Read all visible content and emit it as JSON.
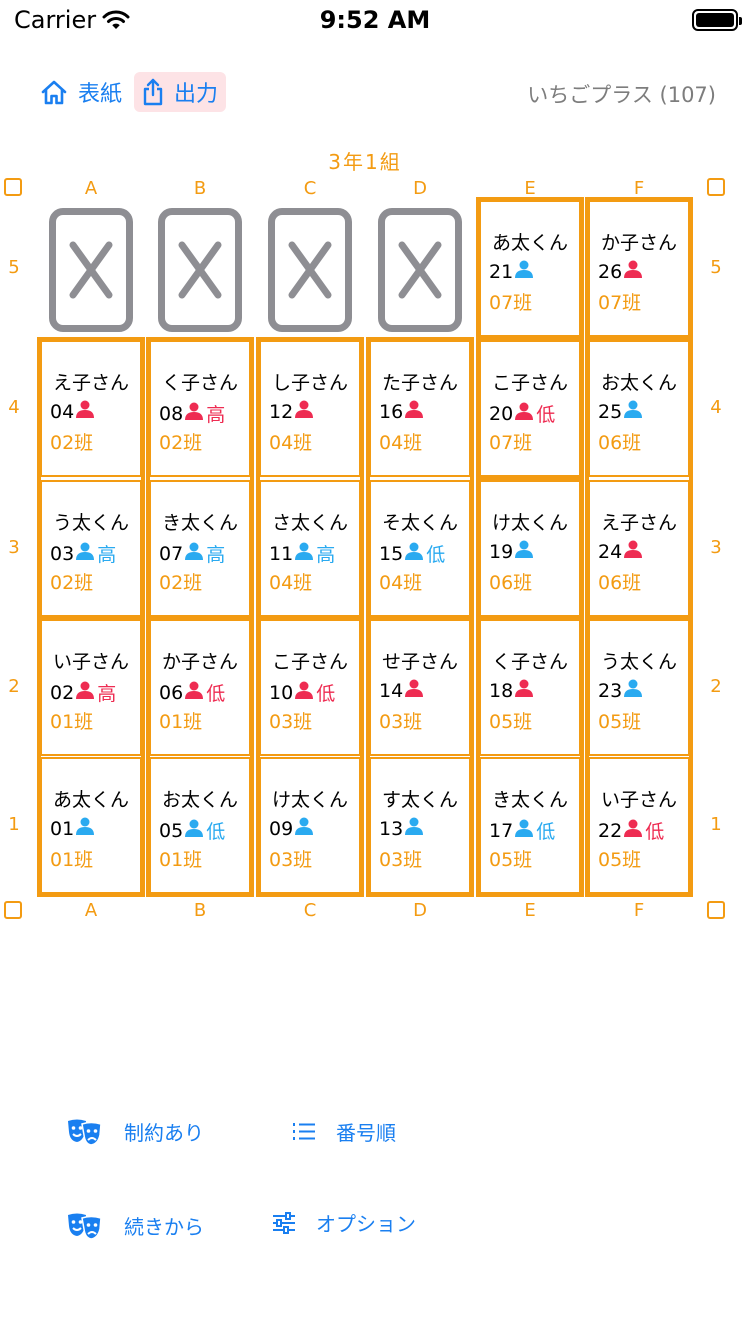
{
  "status_bar": {
    "carrier": "Carrier",
    "time": "9:52 AM"
  },
  "nav": {
    "home_label": "表紙",
    "export_label": "出力",
    "info": "いちごプラス (107)"
  },
  "chart": {
    "class_title": "3年1組",
    "columns": [
      "A",
      "B",
      "C",
      "D",
      "E",
      "F"
    ],
    "rows": [
      "5",
      "4",
      "3",
      "2",
      "1"
    ],
    "empty_seats": [
      {
        "col": "A",
        "row": "5",
        "mark": "X"
      },
      {
        "col": "B",
        "row": "5",
        "mark": "X"
      },
      {
        "col": "C",
        "row": "5",
        "mark": "X"
      },
      {
        "col": "D",
        "row": "5",
        "mark": "X"
      }
    ],
    "seats": [
      {
        "col": "E",
        "row": "5",
        "name": "あ太くん",
        "number": "21",
        "gender": "boy",
        "level": "",
        "group": "07班"
      },
      {
        "col": "F",
        "row": "5",
        "name": "か子さん",
        "number": "26",
        "gender": "girl",
        "level": "",
        "group": "07班"
      },
      {
        "col": "A",
        "row": "4",
        "name": "え子さん",
        "number": "04",
        "gender": "girl",
        "level": "",
        "group": "02班"
      },
      {
        "col": "B",
        "row": "4",
        "name": "く子さん",
        "number": "08",
        "gender": "girl",
        "level": "高",
        "group": "02班"
      },
      {
        "col": "C",
        "row": "4",
        "name": "し子さん",
        "number": "12",
        "gender": "girl",
        "level": "",
        "group": "04班"
      },
      {
        "col": "D",
        "row": "4",
        "name": "た子さん",
        "number": "16",
        "gender": "girl",
        "level": "",
        "group": "04班"
      },
      {
        "col": "E",
        "row": "4",
        "name": "こ子さん",
        "number": "20",
        "gender": "girl",
        "level": "低",
        "group": "07班"
      },
      {
        "col": "F",
        "row": "4",
        "name": "お太くん",
        "number": "25",
        "gender": "boy",
        "level": "",
        "group": "06班"
      },
      {
        "col": "A",
        "row": "3",
        "name": "う太くん",
        "number": "03",
        "gender": "boy",
        "level": "高",
        "group": "02班"
      },
      {
        "col": "B",
        "row": "3",
        "name": "き太くん",
        "number": "07",
        "gender": "boy",
        "level": "高",
        "group": "02班"
      },
      {
        "col": "C",
        "row": "3",
        "name": "さ太くん",
        "number": "11",
        "gender": "boy",
        "level": "高",
        "group": "04班"
      },
      {
        "col": "D",
        "row": "3",
        "name": "そ太くん",
        "number": "15",
        "gender": "boy",
        "level": "低",
        "group": "04班"
      },
      {
        "col": "E",
        "row": "3",
        "name": "け太くん",
        "number": "19",
        "gender": "boy",
        "level": "",
        "group": "06班"
      },
      {
        "col": "F",
        "row": "3",
        "name": "え子さん",
        "number": "24",
        "gender": "girl",
        "level": "",
        "group": "06班"
      },
      {
        "col": "A",
        "row": "2",
        "name": "い子さん",
        "number": "02",
        "gender": "girl",
        "level": "高",
        "group": "01班"
      },
      {
        "col": "B",
        "row": "2",
        "name": "か子さん",
        "number": "06",
        "gender": "girl",
        "level": "低",
        "group": "01班"
      },
      {
        "col": "C",
        "row": "2",
        "name": "こ子さん",
        "number": "10",
        "gender": "girl",
        "level": "低",
        "group": "03班"
      },
      {
        "col": "D",
        "row": "2",
        "name": "せ子さん",
        "number": "14",
        "gender": "girl",
        "level": "",
        "group": "03班"
      },
      {
        "col": "E",
        "row": "2",
        "name": "く子さん",
        "number": "18",
        "gender": "girl",
        "level": "",
        "group": "05班"
      },
      {
        "col": "F",
        "row": "2",
        "name": "う太くん",
        "number": "23",
        "gender": "boy",
        "level": "",
        "group": "05班"
      },
      {
        "col": "A",
        "row": "1",
        "name": "あ太くん",
        "number": "01",
        "gender": "boy",
        "level": "",
        "group": "01班"
      },
      {
        "col": "B",
        "row": "1",
        "name": "お太くん",
        "number": "05",
        "gender": "boy",
        "level": "低",
        "group": "01班"
      },
      {
        "col": "C",
        "row": "1",
        "name": "け太くん",
        "number": "09",
        "gender": "boy",
        "level": "",
        "group": "03班"
      },
      {
        "col": "D",
        "row": "1",
        "name": "す太くん",
        "number": "13",
        "gender": "boy",
        "level": "",
        "group": "03班"
      },
      {
        "col": "E",
        "row": "1",
        "name": "き太くん",
        "number": "17",
        "gender": "boy",
        "level": "低",
        "group": "05班"
      },
      {
        "col": "F",
        "row": "1",
        "name": "い子さん",
        "number": "22",
        "gender": "girl",
        "level": "低",
        "group": "05班"
      }
    ]
  },
  "menu": {
    "constraint_label": "制約あり",
    "order_label": "番号順",
    "continue_label": "続きから",
    "options_label": "オプション"
  },
  "colors": {
    "accent": "#1a7ff0",
    "orange": "#f39b12",
    "boy": "#2aaaf0",
    "girl": "#ee2c52",
    "empty_border": "#8e8e93"
  },
  "icons": {
    "home": "house-icon",
    "export": "share-icon",
    "person": "person-icon",
    "constraint": "theater-masks-icon",
    "order": "numbered-list-icon",
    "continue": "theater-masks-icon",
    "options": "sliders-icon"
  }
}
